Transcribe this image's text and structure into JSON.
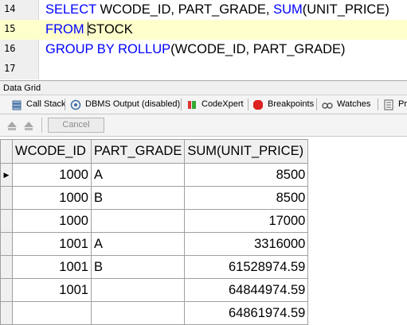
{
  "editor": {
    "lines": [
      {
        "no": "14",
        "tokens": [
          {
            "t": "SELECT",
            "kw": true
          },
          {
            "t": " WCODE_ID, PART_GRADE, ",
            "kw": false
          },
          {
            "t": "SUM",
            "kw": true
          },
          {
            "t": "(UNIT_PRICE)",
            "kw": false
          }
        ]
      },
      {
        "no": "15",
        "current": true,
        "tokens": [
          {
            "t": "FROM",
            "kw": true
          },
          {
            "t": " ",
            "kw": false
          },
          {
            "caret": true
          },
          {
            "t": "STOCK",
            "kw": false
          }
        ]
      },
      {
        "no": "16",
        "tokens": [
          {
            "t": "GROUP BY ROLLUP",
            "kw": true
          },
          {
            "t": "(WCODE_ID, PART_GRADE)",
            "kw": false
          }
        ]
      },
      {
        "no": "17",
        "tokens": []
      }
    ]
  },
  "panel": {
    "title": "Data Grid"
  },
  "tabs": [
    {
      "label": "Call Stack",
      "icon": "call-stack-icon"
    },
    {
      "label": "DBMS Output (disabled)",
      "icon": "dbms-output-icon"
    },
    {
      "label": "CodeXpert",
      "icon": "codexpert-icon"
    },
    {
      "label": "Breakpoints",
      "icon": "breakpoints-icon"
    },
    {
      "label": "Watches",
      "icon": "watches-icon"
    },
    {
      "label": "Pro",
      "icon": "profiler-icon"
    }
  ],
  "toolbar": {
    "cancel_label": "Cancel"
  },
  "grid": {
    "columns": [
      "WCODE_ID",
      "PART_GRADE",
      "SUM(UNIT_PRICE)"
    ],
    "rows": [
      [
        "1000",
        "A",
        "8500"
      ],
      [
        "1000",
        "B",
        "8500"
      ],
      [
        "1000",
        "",
        "17000"
      ],
      [
        "1001",
        "A",
        "3316000"
      ],
      [
        "1001",
        "B",
        "61528974.59"
      ],
      [
        "1001",
        "",
        "64844974.59"
      ],
      [
        "",
        "",
        "64861974.59"
      ]
    ],
    "current_row_indicator": "▶"
  },
  "colors": {
    "keyword": "#0000ff",
    "current_line": "#ffffcc"
  }
}
